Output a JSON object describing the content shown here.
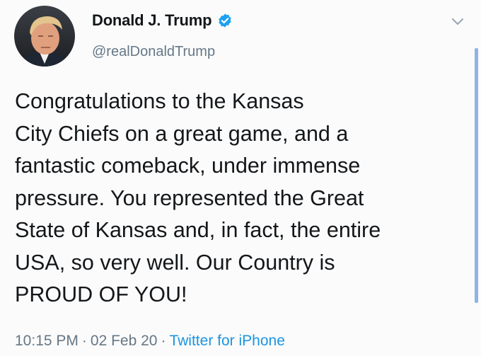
{
  "author": {
    "name": "Donald J. Trump",
    "handle": "@realDonaldTrump",
    "verified": true
  },
  "tweet": {
    "lines": [
      "Congratulations to the Kansas",
      "City Chiefs on a great game, and a",
      "fantastic comeback, under immense",
      "pressure. You represented the Great",
      "and, in fact, the entire",
      "USA, so very well. Our Country is",
      "PROUD OF YOU!"
    ],
    "highlighted_phrase": "State of Kansas",
    "highlight_color": "#f2ec4a"
  },
  "meta": {
    "time": "10:15 PM",
    "separator": "·",
    "date": "02 Feb 20",
    "source": "Twitter for iPhone"
  },
  "colors": {
    "verified_badge": "#1da1f2",
    "link": "#1b95e0",
    "secondary_text": "#657786"
  },
  "icons": {
    "avatar": "profile-photo",
    "verified": "verified-badge-icon",
    "menu": "chevron-down-icon"
  }
}
